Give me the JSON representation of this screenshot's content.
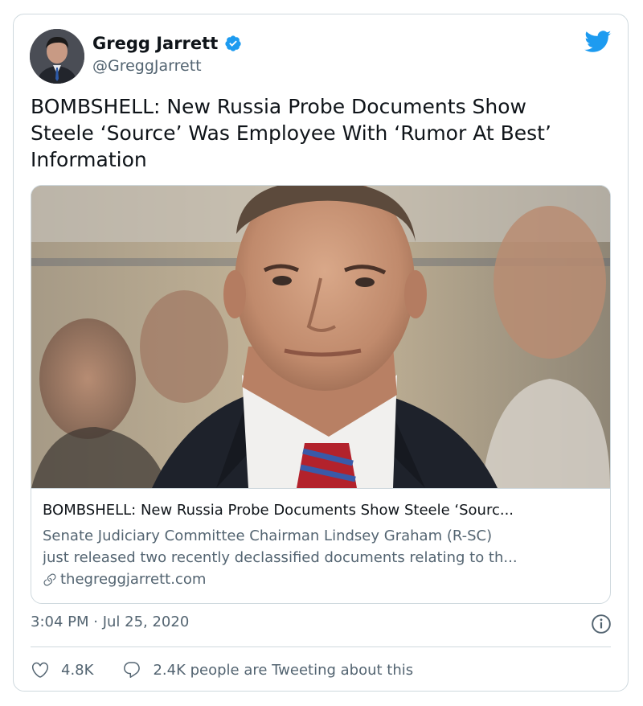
{
  "author": {
    "name": "Gregg Jarrett",
    "handle": "@GreggJarrett",
    "verified": true,
    "avatar_icon": "profile-photo"
  },
  "brand": {
    "icon": "twitter-bird-icon",
    "color": "#1d9bf0"
  },
  "tweet": {
    "text": "BOMBSHELL: New Russia Probe Documents Show\nSteele ‘Source’ Was Employee With ‘Rumor At Best’\nInformation"
  },
  "link_card": {
    "image_description_icon": "article-photo",
    "title": "BOMBSHELL: New Russia Probe Documents Show Steele ‘Sourc...",
    "description_line1": "Senate Judiciary Committee Chairman Lindsey Graham (R-SC)",
    "description_line2": "just released two recently declassified documents relating to th...",
    "domain": "thegreggjarrett.com",
    "domain_icon": "link-icon"
  },
  "meta": {
    "timestamp": "3:04 PM · Jul 25, 2020",
    "info_icon": "info-icon"
  },
  "actions": {
    "likes": "4.8K",
    "like_icon": "heart-icon",
    "reply_text": "2.4K people are Tweeting about this",
    "reply_icon": "speech-bubble-icon"
  },
  "colors": {
    "text_primary": "#0f1419",
    "text_secondary": "#536471",
    "border": "#cfd9de",
    "verified_badge": "#1d9bf0"
  }
}
